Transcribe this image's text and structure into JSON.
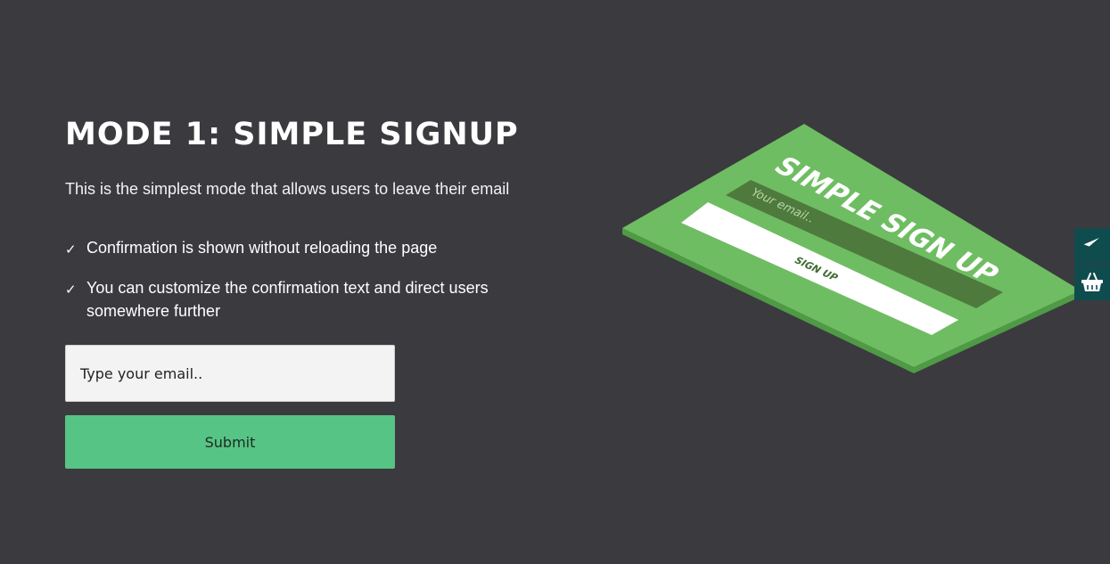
{
  "section": {
    "title": "MODE 1: SIMPLE SIGNUP",
    "subtitle": "This is the simplest mode that allows users to leave their email",
    "features": [
      "Confirmation is shown without reloading the page",
      "You can customize the confirmation text and direct users somewhere further"
    ]
  },
  "form": {
    "email_placeholder": "Type your email..",
    "submit_label": "Submit"
  },
  "illustration": {
    "heading": "SIMPLE SIGN UP",
    "field_placeholder": "Your email..",
    "button_label": "SIGN UP",
    "colors": {
      "card": "#6fbd62",
      "card_edge": "#4f9a45",
      "field": "#4f7a3d",
      "button": "#ffffff"
    }
  },
  "side_buttons": [
    {
      "icon": "paper-plane-icon"
    },
    {
      "icon": "basket-icon"
    }
  ],
  "colors": {
    "background": "#3b3a3f",
    "submit": "#56c485",
    "side_button": "#0f4c4e"
  }
}
